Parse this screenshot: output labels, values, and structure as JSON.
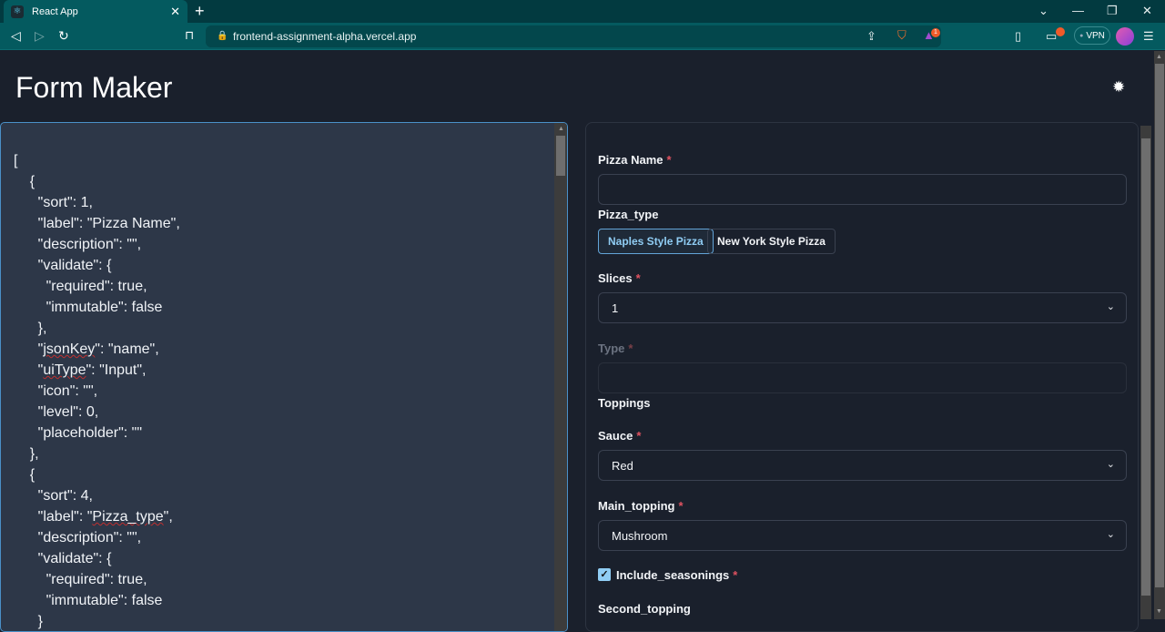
{
  "browser": {
    "tab_title": "React App",
    "tab_close": "✕",
    "new_tab": "+",
    "url": "frontend-assignment-alpha.vercel.app",
    "vpn_label": "VPN",
    "notification_count": "1",
    "window_controls": {
      "dropdown": "⌄",
      "minimize": "—",
      "restore": "❐",
      "close": "✕"
    }
  },
  "app": {
    "title": "Form Maker",
    "theme_toggle_icon": "sun-icon"
  },
  "editor": {
    "json_text_lines": [
      "[",
      "    {",
      "      \"sort\": 1,",
      "      \"label\": \"Pizza Name\",",
      "      \"description\": \"\",",
      "      \"validate\": {",
      "        \"required\": true,",
      "        \"immutable\": false",
      "      },",
      "      \"jsonKey\": \"name\",",
      "      \"uiType\": \"Input\",",
      "      \"icon\": \"\",",
      "      \"level\": 0,",
      "      \"placeholder\": \"\"",
      "    },",
      "    {",
      "      \"sort\": 4,",
      "      \"label\": \"Pizza_type\",",
      "      \"description\": \"\",",
      "      \"validate\": {",
      "        \"required\": true,",
      "        \"immutable\": false",
      "      }"
    ]
  },
  "form": {
    "required_mark": "*",
    "pizza_name": {
      "label": "Pizza Name",
      "value": ""
    },
    "pizza_type": {
      "label": "Pizza_type",
      "options": [
        "Naples Style Pizza",
        "New York Style Pizza"
      ],
      "selected": "Naples Style Pizza"
    },
    "slices": {
      "label": "Slices",
      "value": "1"
    },
    "type": {
      "label": "Type",
      "value": "",
      "disabled": true
    },
    "toppings": {
      "label": "Toppings"
    },
    "sauce": {
      "label": "Sauce",
      "value": "Red"
    },
    "main_topping": {
      "label": "Main_topping",
      "value": "Mushroom"
    },
    "include_seasonings": {
      "label": "Include_seasonings",
      "checked": true
    },
    "second_topping": {
      "label": "Second_topping"
    }
  },
  "colors": {
    "accent": "#90cdf4",
    "required": "#e05260",
    "background": "#1a202c",
    "editor_bg": "#2d3748",
    "browser_chrome": "#045a5f"
  }
}
